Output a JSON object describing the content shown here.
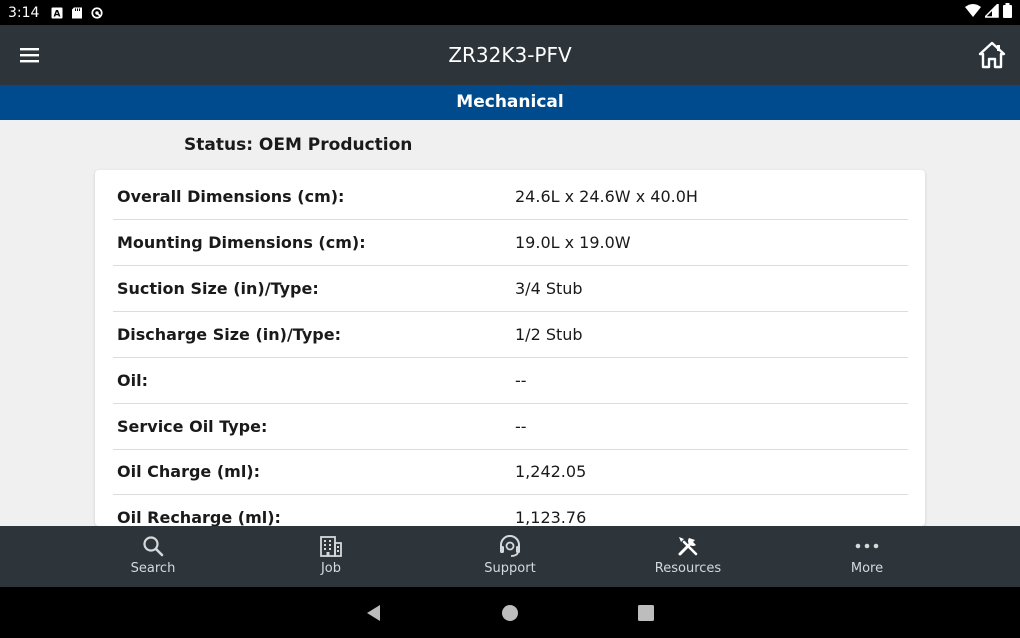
{
  "status_bar": {
    "time": "3:14"
  },
  "app_bar": {
    "title": "ZR32K3-PFV"
  },
  "section": {
    "title": "Mechanical"
  },
  "status_line": "Status: OEM Production",
  "specs": [
    {
      "label": "Overall Dimensions (cm):",
      "value": "24.6L x 24.6W x 40.0H"
    },
    {
      "label": "Mounting Dimensions (cm):",
      "value": "19.0L x 19.0W"
    },
    {
      "label": "Suction Size (in)/Type:",
      "value": "3/4 Stub"
    },
    {
      "label": "Discharge Size (in)/Type:",
      "value": "1/2 Stub"
    },
    {
      "label": "Oil:",
      "value": "--"
    },
    {
      "label": "Service Oil Type:",
      "value": "--"
    },
    {
      "label": "Oil Charge (ml):",
      "value": "1,242.05"
    },
    {
      "label": "Oil Recharge (ml):",
      "value": "1,123.76"
    }
  ],
  "bottom_nav": [
    {
      "label": "Search",
      "icon": "search-icon"
    },
    {
      "label": "Job",
      "icon": "building-icon"
    },
    {
      "label": "Support",
      "icon": "headset-icon"
    },
    {
      "label": "Resources",
      "icon": "tools-icon"
    },
    {
      "label": "More",
      "icon": "more-dots-icon"
    }
  ],
  "colors": {
    "app_bar": "#2d353b",
    "section_bar": "#004b8d",
    "background": "#f0f0f0"
  }
}
